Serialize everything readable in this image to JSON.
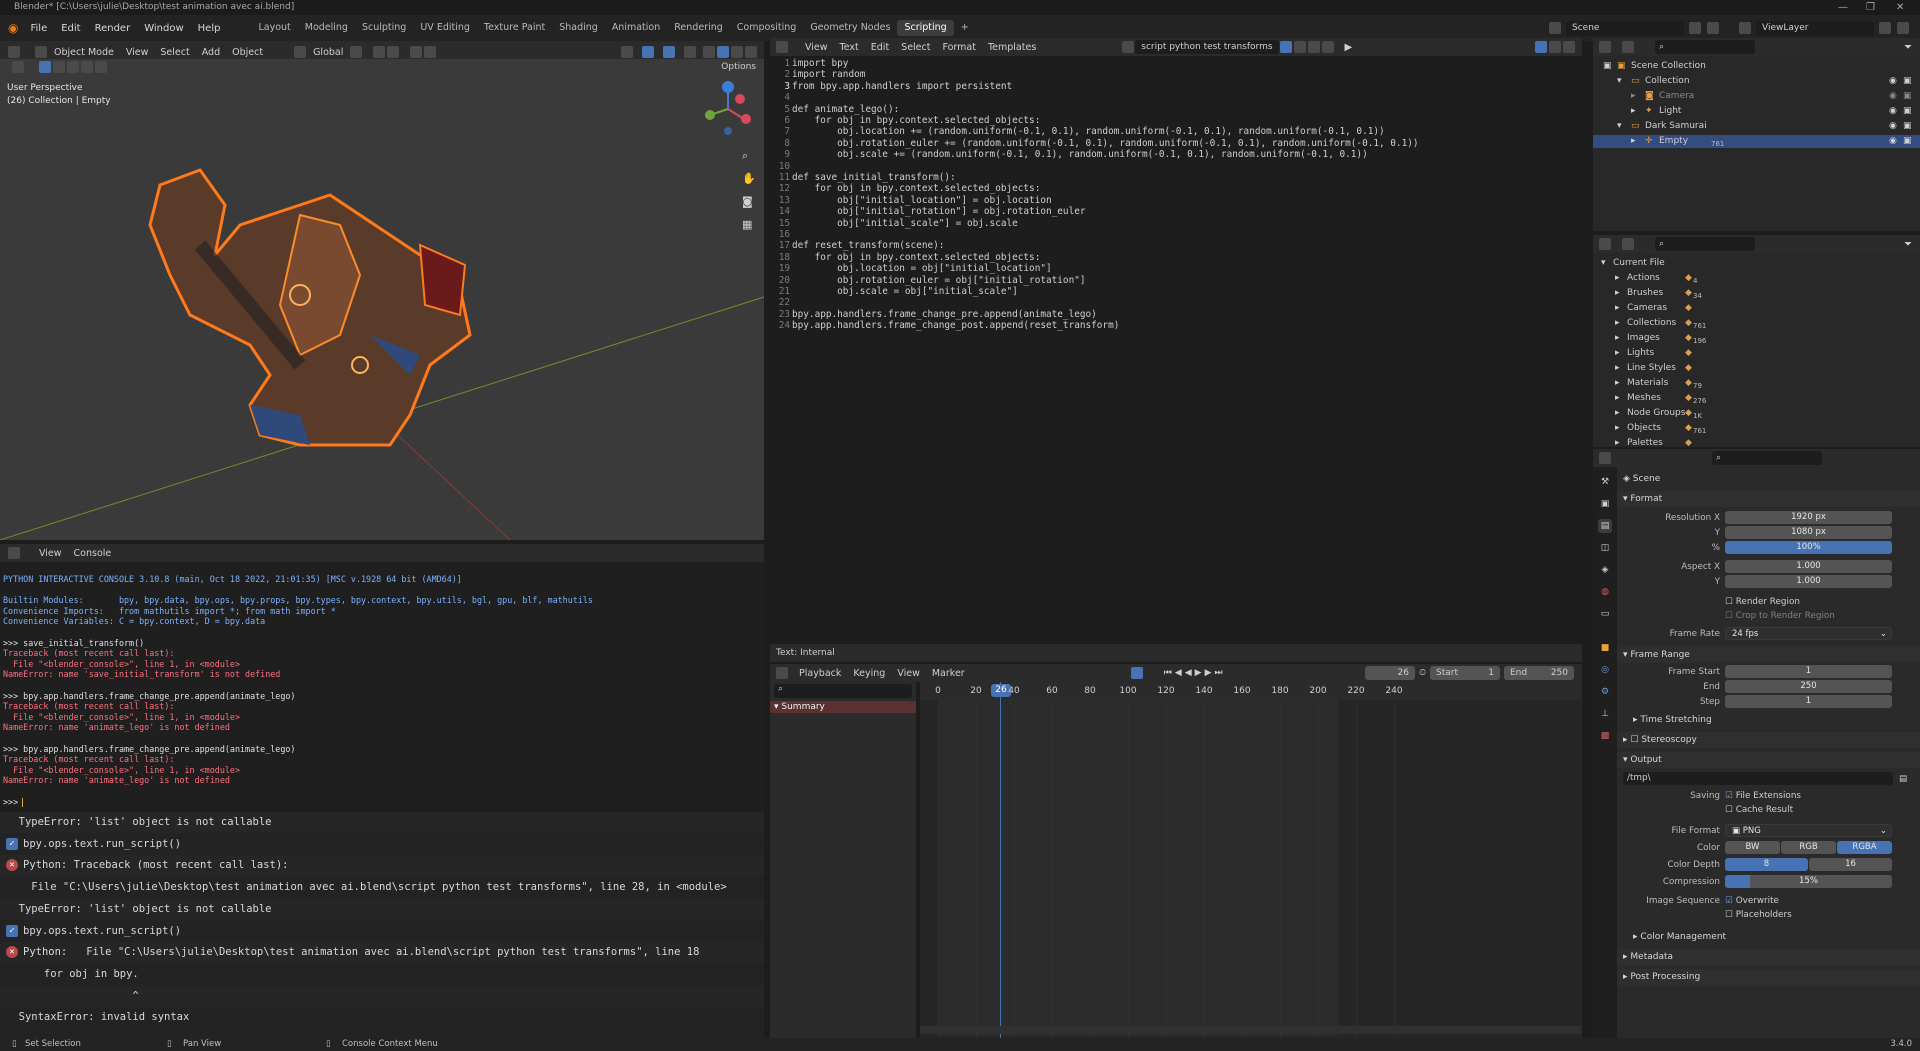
{
  "window": {
    "title": "Blender* [C:\\Users\\julie\\Desktop\\test animation avec ai.blend]",
    "version": "3.4.0"
  },
  "topmenu": [
    "File",
    "Edit",
    "Render",
    "Window",
    "Help"
  ],
  "workspaces": [
    "Layout",
    "Modeling",
    "Sculpting",
    "UV Editing",
    "Texture Paint",
    "Shading",
    "Animation",
    "Rendering",
    "Compositing",
    "Geometry Nodes",
    "Scripting"
  ],
  "active_workspace": "Scripting",
  "scene_name": "Scene",
  "view_layer": "ViewLayer",
  "viewport": {
    "mode": "Object Mode",
    "menus": [
      "View",
      "Select",
      "Add",
      "Object"
    ],
    "transform": "Global",
    "options": "Options",
    "perspective": "User Perspective",
    "collection_info": "(26) Collection | Empty"
  },
  "text_editor": {
    "menus": [
      "View",
      "Text",
      "Edit",
      "Select",
      "Format",
      "Templates"
    ],
    "file_name": "script python test transforms",
    "footer": "Text: Internal",
    "code_lines": [
      "import bpy",
      "import random",
      "from bpy.app.handlers import persistent",
      "",
      "def animate_lego():",
      "    for obj in bpy.context.selected_objects:",
      "        obj.location += (random.uniform(-0.1, 0.1), random.uniform(-0.1, 0.1), random.uniform(-0.1, 0.1))",
      "        obj.rotation_euler += (random.uniform(-0.1, 0.1), random.uniform(-0.1, 0.1), random.uniform(-0.1, 0.1))",
      "        obj.scale += (random.uniform(-0.1, 0.1), random.uniform(-0.1, 0.1), random.uniform(-0.1, 0.1))",
      "",
      "def save_initial_transform():",
      "    for obj in bpy.context.selected_objects:",
      "        obj[\"initial_location\"] = obj.location",
      "        obj[\"initial_rotation\"] = obj.rotation_euler",
      "        obj[\"initial_scale\"] = obj.scale",
      "",
      "def reset_transform(scene):",
      "    for obj in bpy.context.selected_objects:",
      "        obj.location = obj[\"initial_location\"]",
      "        obj.rotation_euler = obj[\"initial_rotation\"]",
      "        obj.scale = obj[\"initial_scale\"]",
      "",
      "bpy.app.handlers.frame_change_pre.append(animate_lego)",
      "bpy.app.handlers.frame_change_post.append(reset_transform)"
    ]
  },
  "console": {
    "menus": [
      "View",
      "Console"
    ],
    "lines": [
      {
        "t": "PYTHON INTERACTIVE CONSOLE 3.10.8 (main, Oct 18 2022, 21:01:35) [MSC v.1928 64 bit (AMD64)]",
        "c": "#7cb1ff"
      },
      {
        "t": "",
        "c": "#ccc"
      },
      {
        "t": "Builtin Modules:       bpy, bpy.data, bpy.ops, bpy.props, bpy.types, bpy.context, bpy.utils, bgl, gpu, blf, mathutils",
        "c": "#7cb1ff"
      },
      {
        "t": "Convenience Imports:   from mathutils import *; from math import *",
        "c": "#7cb1ff"
      },
      {
        "t": "Convenience Variables: C = bpy.context, D = bpy.data",
        "c": "#7cb1ff"
      },
      {
        "t": "",
        "c": "#ccc"
      },
      {
        "t": ">>> save_initial_transform()",
        "c": "#e0e0e0"
      },
      {
        "t": "Traceback (most recent call last):",
        "c": "#ff6f7d"
      },
      {
        "t": "  File \"<blender_console>\", line 1, in <module>",
        "c": "#ff6f7d"
      },
      {
        "t": "NameError: name 'save_initial_transform' is not defined",
        "c": "#ff6f7d"
      },
      {
        "t": "",
        "c": "#ccc"
      },
      {
        "t": ">>> bpy.app.handlers.frame_change_pre.append(animate_lego)",
        "c": "#e0e0e0"
      },
      {
        "t": "Traceback (most recent call last):",
        "c": "#ff6f7d"
      },
      {
        "t": "  File \"<blender_console>\", line 1, in <module>",
        "c": "#ff6f7d"
      },
      {
        "t": "NameError: name 'animate_lego' is not defined",
        "c": "#ff6f7d"
      },
      {
        "t": "",
        "c": "#ccc"
      },
      {
        "t": ">>> bpy.app.handlers.frame_change_pre.append(animate_lego)",
        "c": "#e0e0e0"
      },
      {
        "t": "Traceback (most recent call last):",
        "c": "#ff6f7d"
      },
      {
        "t": "  File \"<blender_console>\", line 1, in <module>",
        "c": "#ff6f7d"
      },
      {
        "t": "NameError: name 'animate_lego' is not defined",
        "c": "#ff6f7d"
      },
      {
        "t": "",
        "c": "#ccc"
      },
      {
        "t": ">>> ",
        "c": "#e0e0e0"
      }
    ]
  },
  "info_log": [
    {
      "icon": "",
      "text": "  TypeError: 'list' object is not callable"
    },
    {
      "icon": "check",
      "text": "bpy.ops.text.run_script()"
    },
    {
      "icon": "error",
      "text": "Python: Traceback (most recent call last):"
    },
    {
      "icon": "",
      "text": "    File \"C:\\Users\\julie\\Desktop\\test animation avec ai.blend\\script python test transforms\", line 28, in <module>"
    },
    {
      "icon": "",
      "text": "  TypeError: 'list' object is not callable"
    },
    {
      "icon": "check",
      "text": "bpy.ops.text.run_script()"
    },
    {
      "icon": "error",
      "text": "Python:   File \"C:\\Users\\julie\\Desktop\\test animation avec ai.blend\\script python test transforms\", line 18"
    },
    {
      "icon": "",
      "text": "      for obj in bpy."
    },
    {
      "icon": "",
      "text": "                    ^"
    },
    {
      "icon": "",
      "text": "  SyntaxError: invalid syntax"
    }
  ],
  "statusbar": [
    "Set Selection",
    "Pan View",
    "Console Context Menu"
  ],
  "outliner": {
    "rows": [
      {
        "label": "Scene Collection",
        "indent": 0
      },
      {
        "label": "Collection",
        "indent": 1
      },
      {
        "label": "Camera",
        "indent": 2
      },
      {
        "label": "Light",
        "indent": 2
      },
      {
        "label": "Dark Samurai",
        "indent": 1
      },
      {
        "label": "Empty",
        "indent": 2,
        "badge": "761"
      }
    ]
  },
  "blend_data": {
    "root": "Current File",
    "rows": [
      {
        "label": "Actions",
        "badge": "4"
      },
      {
        "label": "Brushes",
        "badge": "34"
      },
      {
        "label": "Cameras",
        "badge": ""
      },
      {
        "label": "Collections",
        "badge": "761"
      },
      {
        "label": "Images",
        "badge": "196"
      },
      {
        "label": "Lights",
        "badge": ""
      },
      {
        "label": "Line Styles",
        "badge": ""
      },
      {
        "label": "Materials",
        "badge": "79"
      },
      {
        "label": "Meshes",
        "badge": "276"
      },
      {
        "label": "Node Groups",
        "badge": "1K"
      },
      {
        "label": "Objects",
        "badge": "761"
      },
      {
        "label": "Palettes",
        "badge": ""
      }
    ]
  },
  "properties": {
    "context": "Scene",
    "format_title": "Format",
    "resolution_x_label": "Resolution X",
    "resolution_x": "1920 px",
    "y_label": "Y",
    "resolution_y": "1080 px",
    "pct_label": "%",
    "resolution_pct": "100%",
    "aspect_x_label": "Aspect X",
    "aspect_x": "1.000",
    "aspect_y": "1.000",
    "render_region": "Render Region",
    "crop_region": "Crop to Render Region",
    "frame_rate_label": "Frame Rate",
    "frame_rate": "24 fps",
    "frame_range_title": "Frame Range",
    "frame_start_label": "Frame Start",
    "frame_start": "1",
    "end_label": "End",
    "frame_end": "250",
    "step_label": "Step",
    "frame_step": "1",
    "time_stretching": "Time Stretching",
    "stereoscopy": "Stereoscopy",
    "output_title": "Output",
    "output_path": "/tmp\\",
    "saving_label": "Saving",
    "file_extensions": "File Extensions",
    "cache_result": "Cache Result",
    "file_format_label": "File Format",
    "file_format": "PNG",
    "color_label": "Color",
    "color_opts": [
      "BW",
      "RGB",
      "RGBA"
    ],
    "color_depth_label": "Color Depth",
    "depth_opts": [
      "8",
      "16"
    ],
    "compression_label": "Compression",
    "compression": "15%",
    "image_sequence_label": "Image Sequence",
    "overwrite": "Overwrite",
    "placeholders": "Placeholders",
    "color_management": "Color Management",
    "metadata": "Metadata",
    "post_processing": "Post Processing"
  },
  "timeline": {
    "menus": [
      "Playback",
      "Keying",
      "View",
      "Marker"
    ],
    "current_frame": "26",
    "start_label": "Start",
    "start": "1",
    "end_label": "End",
    "end": "250",
    "summary": "Summary",
    "ticks": [
      "0",
      "20",
      "40",
      "60",
      "80",
      "100",
      "120",
      "140",
      "160",
      "180",
      "200",
      "220",
      "240"
    ]
  }
}
